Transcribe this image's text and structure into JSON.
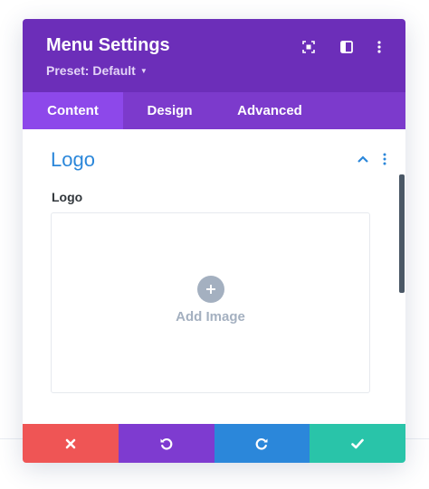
{
  "header": {
    "title": "Menu Settings",
    "preset_label": "Preset: Default",
    "icons": [
      "focus-icon",
      "sidebar-toggle-icon",
      "more-options-icon"
    ]
  },
  "tabs": [
    {
      "label": "Content",
      "active": true
    },
    {
      "label": "Design",
      "active": false
    },
    {
      "label": "Advanced",
      "active": false
    }
  ],
  "section": {
    "title": "Logo",
    "expanded": true,
    "icons": [
      "chevron-up-icon",
      "more-options-icon"
    ]
  },
  "field": {
    "label": "Logo",
    "upload_label": "Add Image",
    "upload_icon": "plus-icon"
  },
  "footer": {
    "buttons": [
      {
        "name": "discard",
        "icon": "close-icon",
        "color": "#ef5555"
      },
      {
        "name": "undo",
        "icon": "undo-icon",
        "color": "#7e3bd0"
      },
      {
        "name": "redo",
        "icon": "redo-icon",
        "color": "#2b87da"
      },
      {
        "name": "save",
        "icon": "check-icon",
        "color": "#29c4a9"
      }
    ]
  },
  "colors": {
    "header_bg": "#6c2eb9",
    "tabs_bg": "#7c3acc",
    "active_tab_bg": "#8d48ea",
    "accent": "#2b87da"
  }
}
